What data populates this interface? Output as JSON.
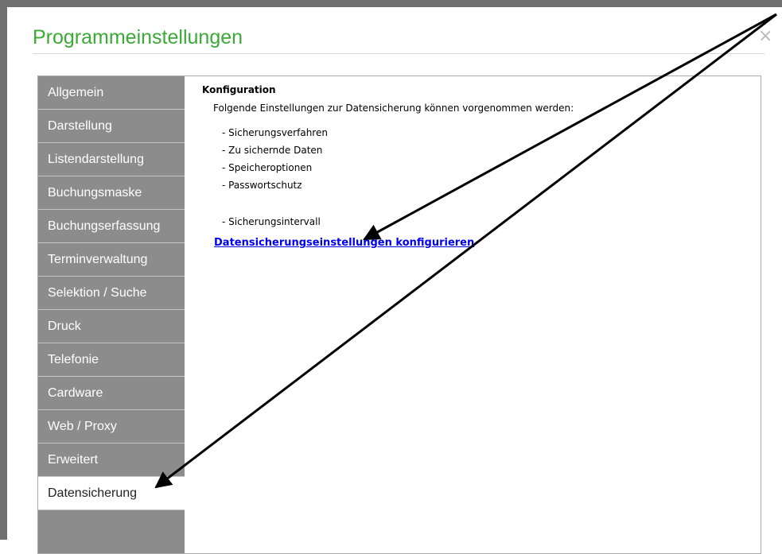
{
  "window": {
    "title": "Programmeinstellungen",
    "close_label": "×"
  },
  "sidebar": {
    "items": [
      {
        "label": "Allgemein"
      },
      {
        "label": "Darstellung"
      },
      {
        "label": "Listendarstellung"
      },
      {
        "label": "Buchungsmaske"
      },
      {
        "label": "Buchungserfassung"
      },
      {
        "label": "Terminverwaltung"
      },
      {
        "label": "Selektion / Suche"
      },
      {
        "label": "Druck"
      },
      {
        "label": "Telefonie"
      },
      {
        "label": "Cardware"
      },
      {
        "label": "Web / Proxy"
      },
      {
        "label": "Erweitert"
      },
      {
        "label": "Datensicherung",
        "active": true
      }
    ]
  },
  "content": {
    "heading": "Konfiguration",
    "description": "Folgende Einstellungen zur Datensicherung können vorgenommen werden:",
    "options": [
      "- Sicherungsverfahren",
      "- Zu sichernde Daten",
      "- Speicheroptionen",
      "- Passwortschutz",
      "",
      "- Sicherungsintervall"
    ],
    "link_label": "Datensicherungseinstellungen konfigurieren"
  },
  "colors": {
    "title_green": "#3aa935",
    "sidebar_gray": "#8c8c8c",
    "link_blue": "#0000ee",
    "annotation_arrows": "#000000"
  }
}
